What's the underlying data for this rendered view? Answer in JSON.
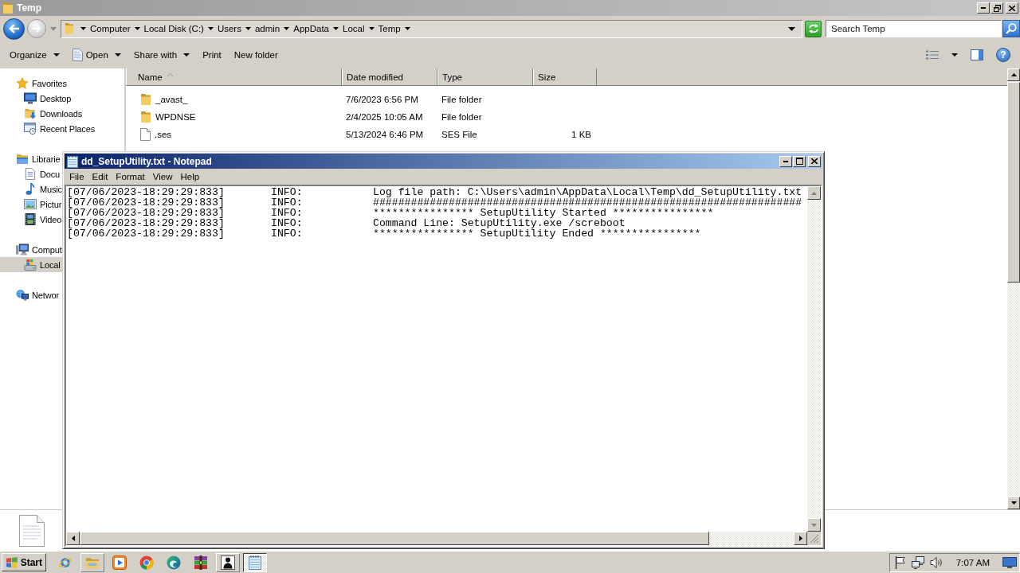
{
  "explorer": {
    "title": "Temp",
    "active": false,
    "maximized": true,
    "back": {
      "disabled": false
    },
    "forward": {
      "disabled": true
    },
    "address": [
      "Computer",
      "Local Disk (C:)",
      "Users",
      "admin",
      "AppData",
      "Local",
      "Temp"
    ],
    "search": {
      "placeholder": "Search Temp"
    },
    "toolbar": [
      {
        "label": "Organize",
        "kind": "menu"
      },
      {
        "label": "Open",
        "kind": "icon_menu"
      },
      {
        "label": "Share with",
        "kind": "menu"
      },
      {
        "label": "Print",
        "kind": "plain"
      },
      {
        "label": "New folder",
        "kind": "plain"
      }
    ],
    "help": "?",
    "nav": [
      {
        "label": "Favorites",
        "kind": "favorites",
        "selected": false,
        "children": [
          {
            "label": "Desktop",
            "kind": "desktop",
            "selected": false
          },
          {
            "label": "Downloads",
            "kind": "downloads",
            "selected": false
          },
          {
            "label": "Recent Places",
            "kind": "recent",
            "selected": false
          }
        ]
      },
      {
        "label": "Librarie",
        "kind": "libraries",
        "selected": false,
        "children": [
          {
            "label": "Docu",
            "kind": "documents",
            "selected": false
          },
          {
            "label": "Music",
            "kind": "music",
            "selected": false
          },
          {
            "label": "Pictur",
            "kind": "pictures",
            "selected": false
          },
          {
            "label": "Video",
            "kind": "videos",
            "selected": false
          }
        ]
      },
      {
        "label": "Comput",
        "kind": "computer",
        "selected": false,
        "children": [
          {
            "label": "Local",
            "kind": "disk",
            "selected": true
          }
        ]
      },
      {
        "label": "Networ",
        "kind": "network",
        "selected": false
      }
    ],
    "columns": [
      {
        "label": "Name",
        "sorted": true
      },
      {
        "label": "Date modified",
        "sorted": false
      },
      {
        "label": "Type",
        "sorted": false
      },
      {
        "label": "Size",
        "sorted": false
      }
    ],
    "files": [
      {
        "name": "_avast_",
        "date": "7/6/2023 6:56 PM",
        "type": "File folder",
        "kind": "folder",
        "selected": false
      },
      {
        "name": "WPDNSE",
        "date": "2/4/2025 10:05 AM",
        "type": "File folder",
        "kind": "folder",
        "selected": false
      },
      {
        "name": ".ses",
        "date": "5/13/2024 6:46 PM",
        "type": "SES File",
        "size": "1 KB",
        "kind": "file",
        "selected": false
      }
    ]
  },
  "notepad": {
    "title": "dd_SetupUtility.txt - Notepad",
    "active": true,
    "maximized": false,
    "menu": [
      "File",
      "Edit",
      "Format",
      "View",
      "Help"
    ],
    "lines": [
      {
        "time": "[07/06/2023-18:29:29:833]",
        "level": "INFO:",
        "message": "Log file path: C:\\Users\\admin\\AppData\\Local\\Temp\\dd_SetupUtility.txt"
      },
      {
        "time": "[07/06/2023-18:29:29:833]",
        "level": "INFO:",
        "message": "####################################################################"
      },
      {
        "time": "[07/06/2023-18:29:29:833]",
        "level": "INFO:",
        "message": "**************** SetupUtility Started ****************"
      },
      {
        "time": "[07/06/2023-18:29:29:833]",
        "level": "INFO:",
        "message": "Command Line: SetupUtility.exe /screboot"
      },
      {
        "time": "[07/06/2023-18:29:29:833]",
        "level": "INFO:",
        "message": "**************** SetupUtility Ended ****************"
      }
    ]
  },
  "taskbar": {
    "start": "Start",
    "apps": [
      {
        "kind": "e_globe",
        "running": false,
        "selected": false
      },
      {
        "kind": "folder",
        "running": true,
        "selected": false
      },
      {
        "kind": "play",
        "running": false,
        "selected": false
      },
      {
        "kind": "tricolor",
        "running": false,
        "selected": false
      },
      {
        "kind": "swirl",
        "running": false,
        "selected": false
      },
      {
        "kind": "books",
        "running": false,
        "selected": false
      },
      {
        "kind": "figure",
        "running": true,
        "selected": false
      },
      {
        "kind": "notepad",
        "running": true,
        "selected": true
      }
    ],
    "clock": "7:07 AM"
  }
}
